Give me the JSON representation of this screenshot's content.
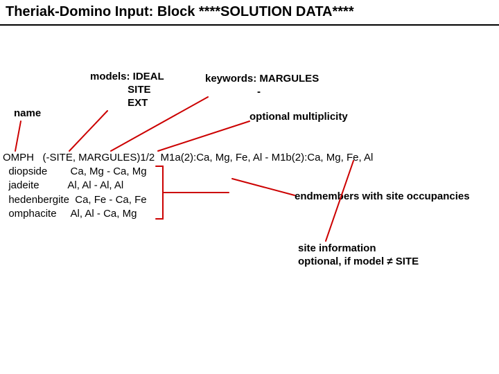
{
  "title": "Theriak-Domino Input: Block ****SOLUTION DATA****",
  "labels": {
    "name": "name",
    "models": "models: IDEAL\n             SITE\n             EXT",
    "keywords": "keywords: MARGULES\n                  -",
    "optMult": "optional multiplicity",
    "endmembers": "endmembers with site occupancies",
    "siteInfo": "site information\noptional, if model ≠ SITE"
  },
  "code": {
    "line1": "OMPH   (-SITE, MARGULES)1/2  M1a(2):Ca, Mg, Fe, Al - M1b(2):Ca, Mg, Fe, Al",
    "block": "  diopside        Ca, Mg - Ca, Mg\n  jadeite          Al, Al - Al, Al\n  hedenbergite  Ca, Fe - Ca, Fe\n  omphacite     Al, Al - Ca, Mg"
  }
}
